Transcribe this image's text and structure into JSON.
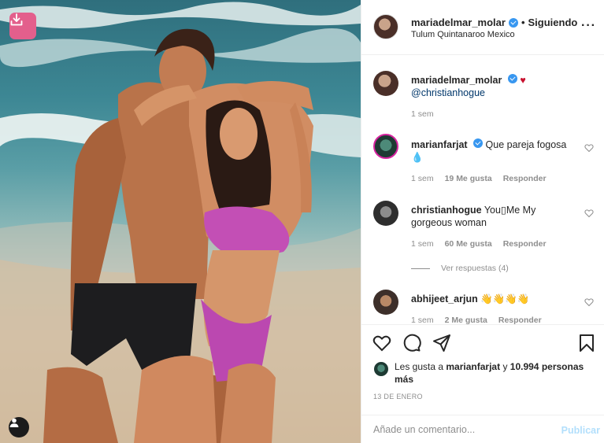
{
  "post": {
    "username": "mariadelmar_molar",
    "follow_status": "Siguiendo",
    "separator": "•",
    "location": "Tulum Quintanaroo Mexico",
    "more_label": "···"
  },
  "caption": {
    "username": "mariadelmar_molar",
    "emoji": "♥",
    "mention": "@christianhogue",
    "time": "1 sem"
  },
  "comments": [
    {
      "username": "marianfarjat",
      "text": "Que pareja fogosa",
      "emoji": "💧",
      "time": "1 sem",
      "likes": "19 Me gusta",
      "reply": "Responder"
    },
    {
      "username": "christianhogue",
      "text": "You▯Me My gorgeous woman",
      "time": "1 sem",
      "likes": "60 Me gusta",
      "reply": "Responder",
      "view_replies": "Ver respuestas (4)"
    },
    {
      "username": "abhijeet_arjun",
      "text": "👋👋👋👋",
      "time": "1 sem",
      "likes": "2 Me gusta",
      "reply": "Responder"
    }
  ],
  "likes": {
    "prefix": "Les gusta a",
    "user": "marianfarjat",
    "conj": "y",
    "others": "10.994 personas más"
  },
  "date": "13 DE ENERO",
  "add_comment": {
    "placeholder": "Añade un comentario...",
    "publish": "Publicar"
  },
  "colors": {
    "verified": "#3897f0",
    "heart_red": "#c8102e",
    "mention": "#00376b",
    "muted": "#8e8e8e",
    "publish_disabled": "#b2dffc",
    "download_button": "#e35f8c"
  },
  "icons": [
    "download-icon",
    "verified-badge-icon",
    "more-options-icon",
    "heart-icon",
    "comment-icon",
    "share-icon",
    "bookmark-icon",
    "user-tag-icon"
  ]
}
